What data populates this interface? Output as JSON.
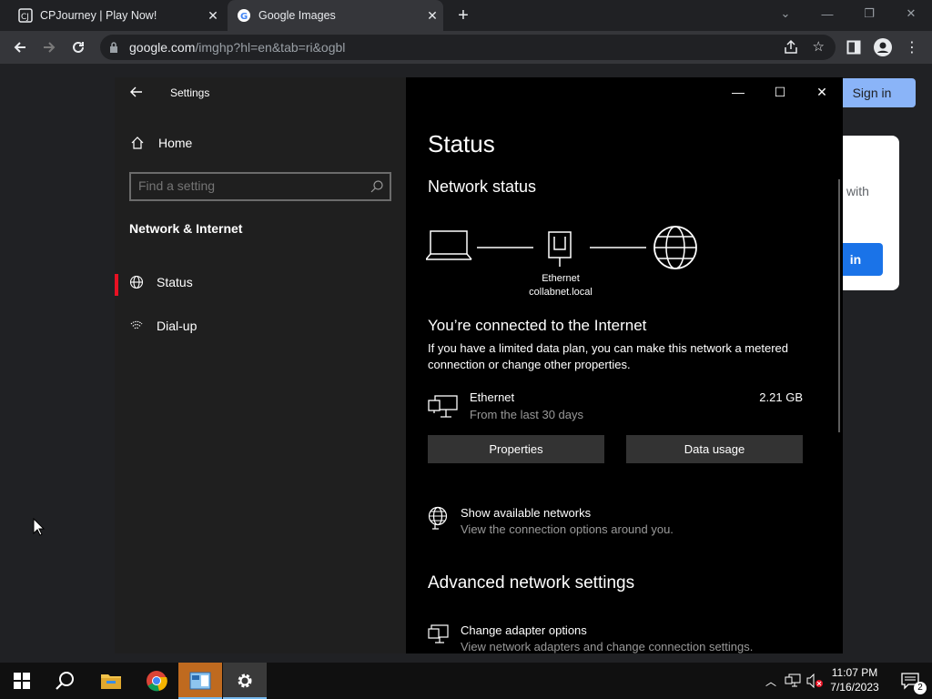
{
  "browser": {
    "tabs": [
      {
        "title": "CPJourney | Play Now!",
        "active": false
      },
      {
        "title": "Google Images",
        "active": true
      }
    ],
    "url_main": "google.com",
    "url_rest": "/imghp?hl=en&tab=ri&ogbl"
  },
  "page": {
    "signin_top": "Sign in",
    "card_text": "with",
    "card_button": "in"
  },
  "settings": {
    "title": "Settings",
    "home": "Home",
    "search_placeholder": "Find a setting",
    "section": "Network & Internet",
    "nav": [
      {
        "label": "Status",
        "selected": true
      },
      {
        "label": "Dial-up",
        "selected": false
      }
    ],
    "heading": "Status",
    "network_status": "Network status",
    "eth_label": "Ethernet",
    "eth_domain": "collabnet.local",
    "connected": "You’re connected to the Internet",
    "desc": "If you have a limited data plan, you can make this network a metered connection or change other properties.",
    "net_name": "Ethernet",
    "net_sub": "From the last 30 days",
    "net_size": "2.21 GB",
    "btn_properties": "Properties",
    "btn_data": "Data usage",
    "show_networks": "Show available networks",
    "show_networks_sub": "View the connection options around you.",
    "advanced": "Advanced network settings",
    "adapter": "Change adapter options",
    "adapter_sub": "View network adapters and change connection settings."
  },
  "taskbar": {
    "time": "11:07 PM",
    "date": "7/16/2023",
    "notif_count": "2"
  },
  "colors": {
    "accent": "#e81123",
    "chrome_blue": "#8ab4f8",
    "google_blue": "#1a73e8"
  }
}
